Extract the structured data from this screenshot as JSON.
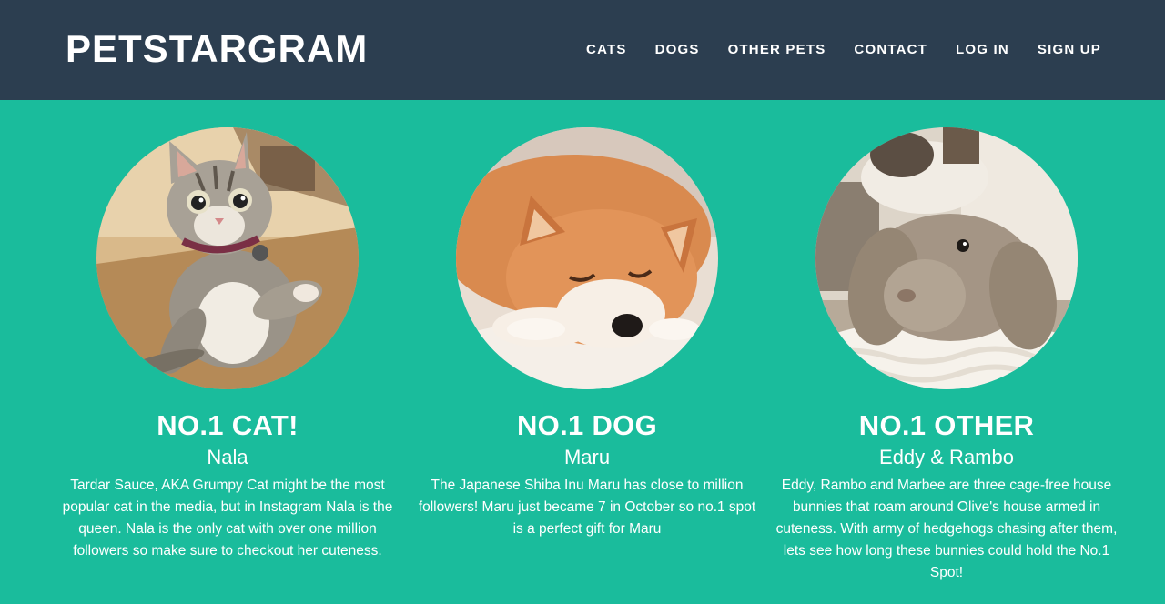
{
  "header": {
    "brand": "PETSTARGRAM",
    "nav": [
      "CATS",
      "DOGS",
      "OTHER PETS",
      "CONTACT",
      "LOG IN",
      "SIGN UP"
    ]
  },
  "colors": {
    "header_bg": "#2c3e50",
    "page_bg": "#1abc9c",
    "text": "#ffffff"
  },
  "cards": [
    {
      "title": "NO.1 CAT!",
      "name": "Nala",
      "image": "photo-of-tabby-cat-sitting",
      "text": "Tardar Sauce, AKA Grumpy Cat might be the most popular cat in the media, but in Instagram Nala is the queen. Nala is the only cat with over one million followers so make sure to checkout her cuteness."
    },
    {
      "title": "NO.1 DOG",
      "name": "Maru",
      "image": "photo-of-sleeping-shiba-inu",
      "text": "The Japanese Shiba Inu Maru has close to million followers! Maru just became 7 in October so no.1 spot is a perfect gift for Maru"
    },
    {
      "title": "NO.1 OTHER",
      "name": "Eddy & Rambo",
      "image": "photo-of-lop-eared-bunnies",
      "text": "Eddy, Rambo and Marbee are three cage-free house bunnies that roam around Olive's house armed in cuteness. With army of hedgehogs chasing after them, lets see how long these bunnies could hold the No.1 Spot!"
    }
  ]
}
